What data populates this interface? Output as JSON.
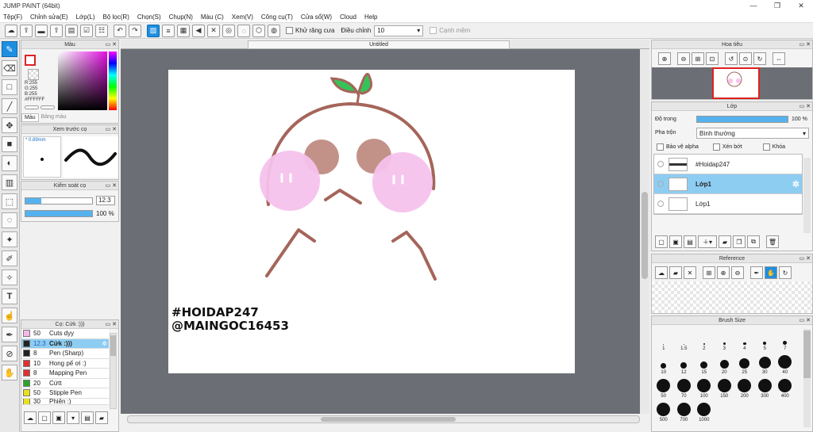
{
  "window": {
    "title": "JUMP PAINT (64bit)"
  },
  "menu": [
    "Tệp(F)",
    "Chỉnh sửa(E)",
    "Lớp(L)",
    "Bộ lọc(R)",
    "Chọn(S)",
    "Chụp(N)",
    "Màu (C)",
    "Xem(V)",
    "Công cụ(T)",
    "Cửa sổ(W)",
    "Cloud",
    "Help"
  ],
  "toolbar": {
    "antialias_label": "Khử răng cưa",
    "adjust_label": "Điều chỉnh",
    "adjust_value": "10",
    "edge_label": "Cạnh mềm"
  },
  "color_panel": {
    "title": "Màu",
    "r": "R:255",
    "g": "G:255",
    "b": "B:255",
    "hex": "#FFFFFF",
    "tab1": "Màu",
    "tab2": "Bảng màu"
  },
  "preview_panel": {
    "title": "Xem trước cọ",
    "size": "* 0.89mm"
  },
  "brush_control": {
    "title": "Kiểm soát cọ",
    "size_value": "12.3",
    "opacity_value": "100 %"
  },
  "brush_list": {
    "title": "Cọ: Cứk :)))",
    "items": [
      {
        "num": "50",
        "name": "Cuts dyy",
        "color": "#f5b8e8",
        "selected": false
      },
      {
        "num": "12.3",
        "name": "Cứk :)))",
        "color": "#222222",
        "selected": true
      },
      {
        "num": "8",
        "name": "Pen (Sharp)",
        "color": "#222222",
        "selected": false
      },
      {
        "num": "10",
        "name": "Hong pế ơi :)",
        "color": "#e03030",
        "selected": false
      },
      {
        "num": "8",
        "name": "Mapping Pen",
        "color": "#e03030",
        "selected": false
      },
      {
        "num": "20",
        "name": "Cứtt",
        "color": "#2aa52a",
        "selected": false
      },
      {
        "num": "50",
        "name": "Stipple Pen",
        "color": "#e8e020",
        "selected": false
      },
      {
        "num": "30",
        "name": "Phiên :)",
        "color": "#e8e020",
        "selected": false
      }
    ]
  },
  "document": {
    "tab": "Untitled",
    "watermark_line1": "#HOIDAP247",
    "watermark_line2": "@MAINGOC16453"
  },
  "navigator": {
    "title": "Hoa tiêu"
  },
  "layers": {
    "title": "Lớp",
    "opacity_label": "Độ trong",
    "opacity_value": "100 %",
    "blend_label": "Pha trộn",
    "blend_value": "Bình thường",
    "protect_alpha": "Bảo vệ alpha",
    "clip": "Xén bớt",
    "lock": "Khóa",
    "items": [
      {
        "name": "#Hoidap247",
        "selected": false
      },
      {
        "name": "Lớp1",
        "selected": true
      },
      {
        "name": "Lớp1",
        "selected": false
      }
    ]
  },
  "reference": {
    "title": "Reference"
  },
  "brush_size": {
    "title": "Brush Size",
    "sizes": [
      "1",
      "1.5",
      "2",
      "3",
      "4",
      "5",
      "7",
      "10",
      "12",
      "15",
      "20",
      "25",
      "30",
      "40",
      "50",
      "70",
      "100",
      "150",
      "200",
      "300",
      "400",
      "500",
      "700",
      "1000"
    ]
  },
  "colors": {
    "accent": "#1d8fe1",
    "selection": "#8ecdf2",
    "canvas_bg": "#6b6f75",
    "line_brown": "#a5655a",
    "blush_pink": "#f6c2ec",
    "leaf_green": "#35c45a"
  }
}
